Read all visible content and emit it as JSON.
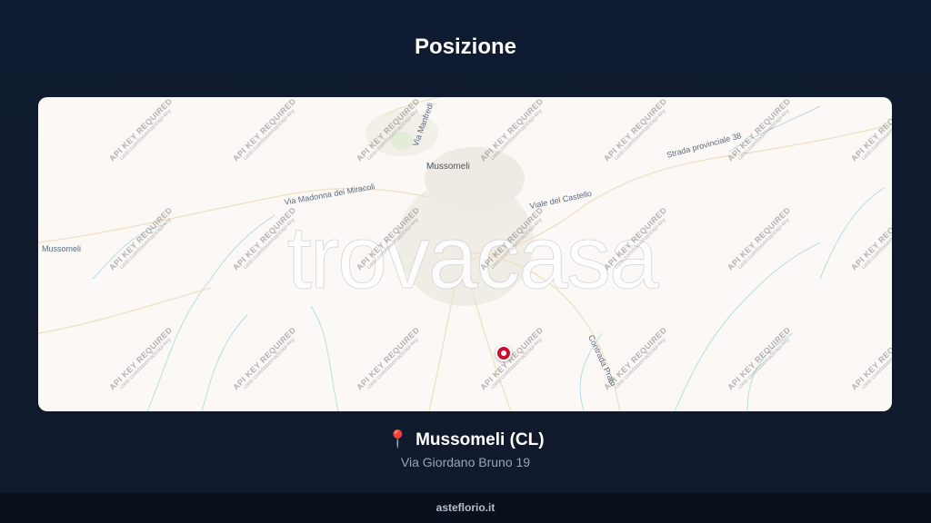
{
  "header": {
    "title": "Posizione"
  },
  "map": {
    "brand_watermark": "trovacasa",
    "watermark_key": "API KEY REQUIRED",
    "watermark_url": "carto.com/basemaps/api-key",
    "labels": {
      "town": "Mussomeli",
      "road_madonna": "Via Madonna dei Miracoli",
      "road_castello": "Viale del Castello",
      "road_provinciale": "Strada provinciale 38",
      "road_contrada": "Contrada Prato",
      "road_west": "Mussomeli",
      "road_north": "Via Manfredi"
    },
    "pin_color": "#c8102e"
  },
  "location": {
    "name": "Mussomeli (CL)",
    "address": "Via Giordano Bruno 19",
    "icon": "map-pin-icon"
  },
  "footer": {
    "site": "asteflorio.it"
  }
}
